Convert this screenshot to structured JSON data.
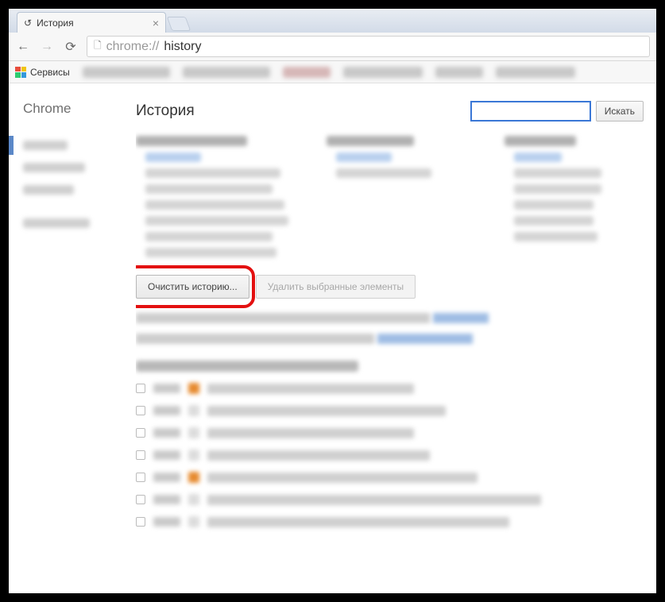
{
  "tab": {
    "title": "История"
  },
  "nav": {
    "url_scheme": "chrome://",
    "url_path": "history"
  },
  "bookmarks_bar": {
    "services_label": "Сервисы"
  },
  "sidebar": {
    "brand": "Chrome"
  },
  "page": {
    "title": "История",
    "search_button": "Искать",
    "clear_history_button": "Очистить историю...",
    "delete_selected_button": "Удалить выбранные элементы"
  }
}
